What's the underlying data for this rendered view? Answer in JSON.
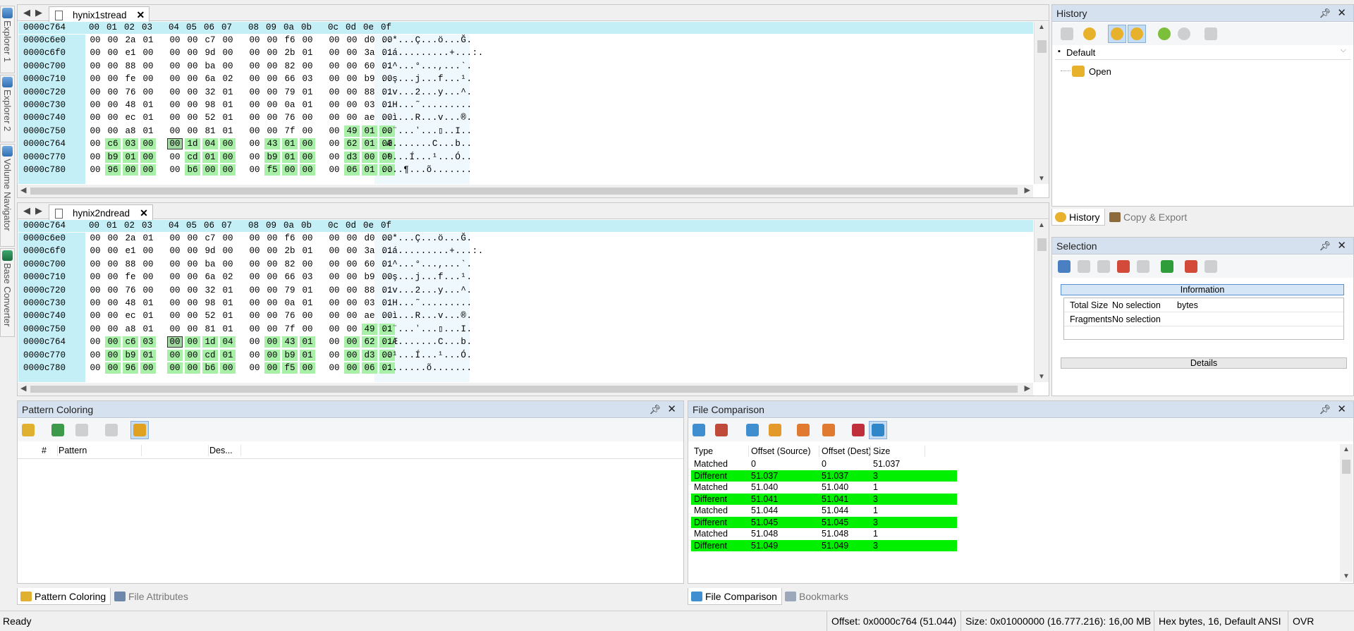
{
  "sidebar_tabs": [
    "Explorer 1",
    "Explorer 2",
    "Volume Navigator",
    "Base Converter"
  ],
  "colors": {
    "header_bg": "#c5eff7",
    "diff_green": "#a8f0a8",
    "different_row": "#00f000",
    "panel_title": "#d5e1ef"
  },
  "header_cols": [
    "00",
    "01",
    "02",
    "03",
    "04",
    "05",
    "06",
    "07",
    "08",
    "09",
    "0a",
    "0b",
    "0c",
    "0d",
    "0e",
    "0f"
  ],
  "editor1": {
    "tab_title": "hynix1stread",
    "header_offset": "0000c764",
    "rows": [
      {
        "off": "0000c6e0",
        "bytes": [
          "00",
          "00",
          "2a",
          "01",
          "00",
          "00",
          "c7",
          "00",
          "00",
          "00",
          "f6",
          "00",
          "00",
          "00",
          "d0",
          "00"
        ],
        "ascii": "..*...Ç...ö...Ğ."
      },
      {
        "off": "0000c6f0",
        "bytes": [
          "00",
          "00",
          "e1",
          "00",
          "00",
          "00",
          "9d",
          "00",
          "00",
          "00",
          "2b",
          "01",
          "00",
          "00",
          "3a",
          "01"
        ],
        "ascii": "..á.........+...:."
      },
      {
        "off": "0000c700",
        "bytes": [
          "00",
          "00",
          "88",
          "00",
          "00",
          "00",
          "ba",
          "00",
          "00",
          "00",
          "82",
          "00",
          "00",
          "00",
          "60",
          "01"
        ],
        "ascii": "..^...°...,...`."
      },
      {
        "off": "0000c710",
        "bytes": [
          "00",
          "00",
          "fe",
          "00",
          "00",
          "00",
          "6a",
          "02",
          "00",
          "00",
          "66",
          "03",
          "00",
          "00",
          "b9",
          "00"
        ],
        "ascii": "..ş...j...f...¹."
      },
      {
        "off": "0000c720",
        "bytes": [
          "00",
          "00",
          "76",
          "00",
          "00",
          "00",
          "32",
          "01",
          "00",
          "00",
          "79",
          "01",
          "00",
          "00",
          "88",
          "01"
        ],
        "ascii": "..v...2...y...^."
      },
      {
        "off": "0000c730",
        "bytes": [
          "00",
          "00",
          "48",
          "01",
          "00",
          "00",
          "98",
          "01",
          "00",
          "00",
          "0a",
          "01",
          "00",
          "00",
          "03",
          "01"
        ],
        "ascii": "..H...˜........."
      },
      {
        "off": "0000c740",
        "bytes": [
          "00",
          "00",
          "ec",
          "01",
          "00",
          "00",
          "52",
          "01",
          "00",
          "00",
          "76",
          "00",
          "00",
          "00",
          "ae",
          "00"
        ],
        "ascii": "..ì...R...v...®."
      },
      {
        "off": "0000c750",
        "bytes": [
          "00",
          "00",
          "a8",
          "01",
          "00",
          "00",
          "81",
          "01",
          "00",
          "00",
          "7f",
          "00",
          "00",
          "49",
          "01",
          "00"
        ],
        "ascii": "..¨...ʼ...▯..I.."
      },
      {
        "off": "0000c764",
        "bytes": [
          "00",
          "c6",
          "03",
          "00",
          "00",
          "1d",
          "04",
          "00",
          "00",
          "43",
          "01",
          "00",
          "00",
          "62",
          "01",
          "00"
        ],
        "ascii": ".Æ.......C...b.."
      },
      {
        "off": "0000c770",
        "bytes": [
          "00",
          "b9",
          "01",
          "00",
          "00",
          "cd",
          "01",
          "00",
          "00",
          "b9",
          "01",
          "00",
          "00",
          "d3",
          "00",
          "00"
        ],
        "ascii": ".¹...Í...¹...Ó.."
      },
      {
        "off": "0000c780",
        "bytes": [
          "00",
          "96",
          "00",
          "00",
          "00",
          "b6",
          "00",
          "00",
          "00",
          "f5",
          "00",
          "00",
          "00",
          "06",
          "01",
          "00"
        ],
        "ascii": "....¶...õ......."
      }
    ]
  },
  "editor2": {
    "tab_title": "hynix2ndread",
    "header_offset": "0000c764",
    "rows": [
      {
        "off": "0000c6e0",
        "bytes": [
          "00",
          "00",
          "2a",
          "01",
          "00",
          "00",
          "c7",
          "00",
          "00",
          "00",
          "f6",
          "00",
          "00",
          "00",
          "d0",
          "00"
        ],
        "ascii": "..*...Ç...ö...Ğ."
      },
      {
        "off": "0000c6f0",
        "bytes": [
          "00",
          "00",
          "e1",
          "00",
          "00",
          "00",
          "9d",
          "00",
          "00",
          "00",
          "2b",
          "01",
          "00",
          "00",
          "3a",
          "01"
        ],
        "ascii": "..á.........+...:."
      },
      {
        "off": "0000c700",
        "bytes": [
          "00",
          "00",
          "88",
          "00",
          "00",
          "00",
          "ba",
          "00",
          "00",
          "00",
          "82",
          "00",
          "00",
          "00",
          "60",
          "01"
        ],
        "ascii": "..^...°...,...`."
      },
      {
        "off": "0000c710",
        "bytes": [
          "00",
          "00",
          "fe",
          "00",
          "00",
          "00",
          "6a",
          "02",
          "00",
          "00",
          "66",
          "03",
          "00",
          "00",
          "b9",
          "00"
        ],
        "ascii": "..ş...j...f...¹."
      },
      {
        "off": "0000c720",
        "bytes": [
          "00",
          "00",
          "76",
          "00",
          "00",
          "00",
          "32",
          "01",
          "00",
          "00",
          "79",
          "01",
          "00",
          "00",
          "88",
          "01"
        ],
        "ascii": "..v...2...y...^."
      },
      {
        "off": "0000c730",
        "bytes": [
          "00",
          "00",
          "48",
          "01",
          "00",
          "00",
          "98",
          "01",
          "00",
          "00",
          "0a",
          "01",
          "00",
          "00",
          "03",
          "01"
        ],
        "ascii": "..H...˜........."
      },
      {
        "off": "0000c740",
        "bytes": [
          "00",
          "00",
          "ec",
          "01",
          "00",
          "00",
          "52",
          "01",
          "00",
          "00",
          "76",
          "00",
          "00",
          "00",
          "ae",
          "00"
        ],
        "ascii": "..ì...R...v...®."
      },
      {
        "off": "0000c750",
        "bytes": [
          "00",
          "00",
          "a8",
          "01",
          "00",
          "00",
          "81",
          "01",
          "00",
          "00",
          "7f",
          "00",
          "00",
          "00",
          "49",
          "01"
        ],
        "ascii": "..¨...ʼ...▯...I."
      },
      {
        "off": "0000c764",
        "bytes": [
          "00",
          "00",
          "c6",
          "03",
          "00",
          "00",
          "1d",
          "04",
          "00",
          "00",
          "43",
          "01",
          "00",
          "00",
          "62",
          "01"
        ],
        "ascii": "..Æ.......C...b."
      },
      {
        "off": "0000c770",
        "bytes": [
          "00",
          "00",
          "b9",
          "01",
          "00",
          "00",
          "cd",
          "01",
          "00",
          "00",
          "b9",
          "01",
          "00",
          "00",
          "d3",
          "00"
        ],
        "ascii": "..¹...Í...¹...Ó."
      },
      {
        "off": "0000c780",
        "bytes": [
          "00",
          "00",
          "96",
          "00",
          "00",
          "00",
          "b6",
          "00",
          "00",
          "00",
          "f5",
          "00",
          "00",
          "00",
          "06",
          "01"
        ],
        "ascii": "........õ......."
      }
    ]
  },
  "history": {
    "title": "History",
    "root": "Default",
    "item": "Open",
    "tabs": [
      "History",
      "Copy & Export"
    ]
  },
  "selection": {
    "title": "Selection",
    "info_header": "Information",
    "rows": [
      {
        "label": "Total Size",
        "value": "No selection",
        "unit": "bytes"
      },
      {
        "label": "Fragments",
        "value": "No selection",
        "unit": ""
      }
    ],
    "details_label": "Details"
  },
  "pattern_coloring": {
    "title": "Pattern Coloring",
    "columns": [
      "#",
      "Pattern",
      "Des..."
    ],
    "tabs": [
      "Pattern Coloring",
      "File Attributes"
    ]
  },
  "file_comparison": {
    "title": "File Comparison",
    "columns": [
      "Type",
      "Offset (Source)",
      "Offset (Dest)",
      "Size"
    ],
    "rows": [
      {
        "type": "Matched",
        "src": "0",
        "dst": "0",
        "size": "51.037"
      },
      {
        "type": "Different",
        "src": "51.037",
        "dst": "51.037",
        "size": "3"
      },
      {
        "type": "Matched",
        "src": "51.040",
        "dst": "51.040",
        "size": "1"
      },
      {
        "type": "Different",
        "src": "51.041",
        "dst": "51.041",
        "size": "3"
      },
      {
        "type": "Matched",
        "src": "51.044",
        "dst": "51.044",
        "size": "1"
      },
      {
        "type": "Different",
        "src": "51.045",
        "dst": "51.045",
        "size": "3"
      },
      {
        "type": "Matched",
        "src": "51.048",
        "dst": "51.048",
        "size": "1"
      },
      {
        "type": "Different",
        "src": "51.049",
        "dst": "51.049",
        "size": "3"
      }
    ],
    "tabs": [
      "File Comparison",
      "Bookmarks"
    ]
  },
  "status": {
    "ready": "Ready",
    "offset": "Offset: 0x0000c764 (51.044)",
    "size": "Size: 0x01000000 (16.777.216): 16,00 MB",
    "mode": "Hex bytes, 16, Default ANSI",
    "ovr": "OVR"
  }
}
